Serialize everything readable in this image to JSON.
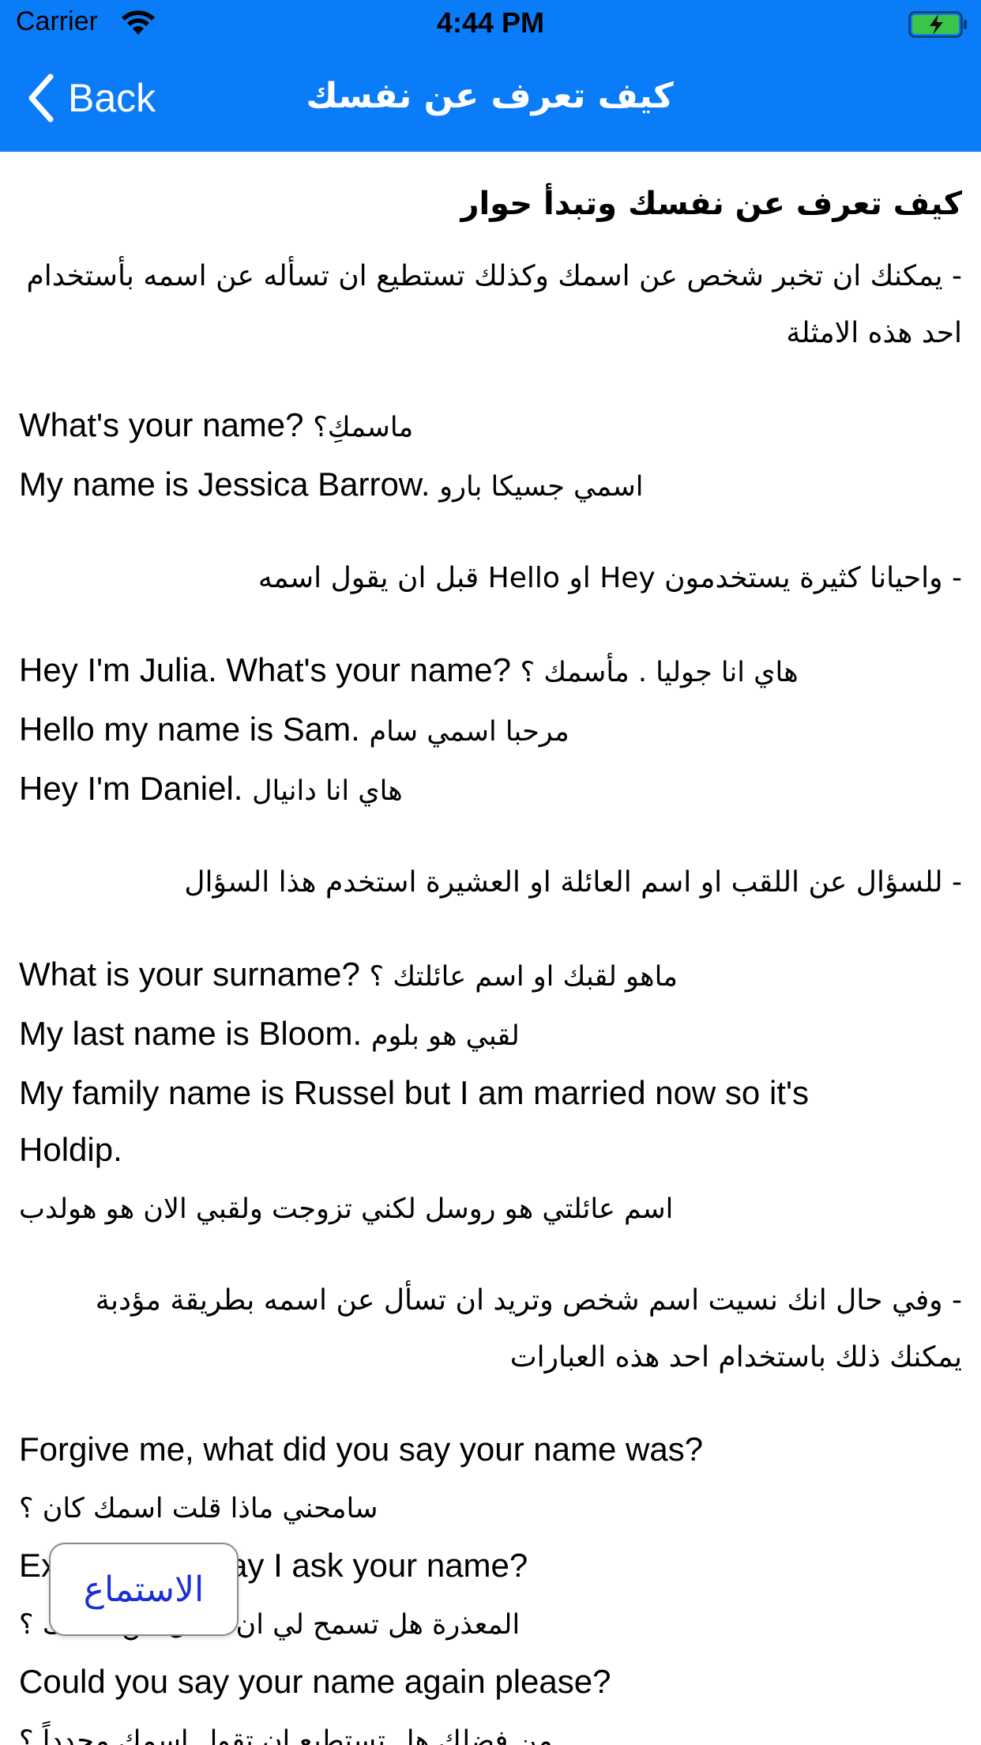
{
  "status_bar": {
    "carrier": "Carrier",
    "time": "4:44 PM",
    "battery_color": "#39c54a"
  },
  "nav": {
    "back_label": "Back",
    "title": "كيف تعرف عن نفسك",
    "background": "#0a7cf8"
  },
  "content": {
    "heading": "كيف تعرف عن نفسك وتبدأ حوار",
    "blocks": [
      {
        "type": "ar",
        "text": "- يمكنك ان تخبر شخص عن اسمك وكذلك تستطيع ان تسأله عن اسمه بأستخدام احد هذه الامثلة"
      },
      {
        "type": "en",
        "lines": [
          {
            "en": "What's your name?",
            "tr": "ماسمكِ؟"
          },
          {
            "en": "My name is Jessica Barrow.",
            "tr": "اسمي جسيكا بارو"
          }
        ]
      },
      {
        "type": "ar",
        "text": "- واحيانا كثيرة يستخدمون Hey او Hello قبل ان يقول اسمه"
      },
      {
        "type": "en",
        "lines": [
          {
            "en": "Hey I'm Julia. What's your name?",
            "tr": "هاي انا جوليا . مأسمك ؟"
          },
          {
            "en": "Hello my name is Sam.",
            "tr": "مرحبا اسمي سام"
          },
          {
            "en": "Hey I'm Daniel.",
            "tr": "هاي انا دانيال"
          }
        ]
      },
      {
        "type": "ar",
        "text": "- للسؤال عن اللقب او اسم العائلة او العشيرة استخدم هذا السؤال"
      },
      {
        "type": "en",
        "lines": [
          {
            "en": "What is your surname?",
            "tr": "ماهو لقبك او اسم عائلتك ؟"
          },
          {
            "en": "My last name is Bloom.",
            "tr": "لقبي هو بلوم"
          },
          {
            "en": "My family name is Russel but I am married now so it's",
            "tr": ""
          },
          {
            "en": "Holdip.",
            "tr": ""
          },
          {
            "en": "",
            "tr": "اسم عائلتي هو روسل لكني تزوجت ولقبي الان هو هولدب"
          }
        ]
      },
      {
        "type": "ar",
        "text": "- وفي حال انك نسيت اسم شخص وتريد ان تسأل عن اسمه بطريقة مؤدبة يمكنك ذلك باستخدام احد هذه العبارات"
      },
      {
        "type": "en",
        "lines": [
          {
            "en": "Forgive me, what did you say your name was?",
            "tr": ""
          },
          {
            "en": "",
            "tr": "سامحني ماذا قلت اسمك كان ؟"
          },
          {
            "en": "Excuse me, may I ask your name?",
            "tr": ""
          },
          {
            "en": "",
            "tr": "المعذرة هل تسمح لي ان اسأل عن اسمك ؟"
          },
          {
            "en": "Could you say your name again please?",
            "tr": ""
          },
          {
            "en": "",
            "tr": "من فضلك هل تستطيع ان تقول اسمك مجدداً ؟"
          }
        ]
      }
    ]
  },
  "listen_button": {
    "label": "الاستماع"
  }
}
